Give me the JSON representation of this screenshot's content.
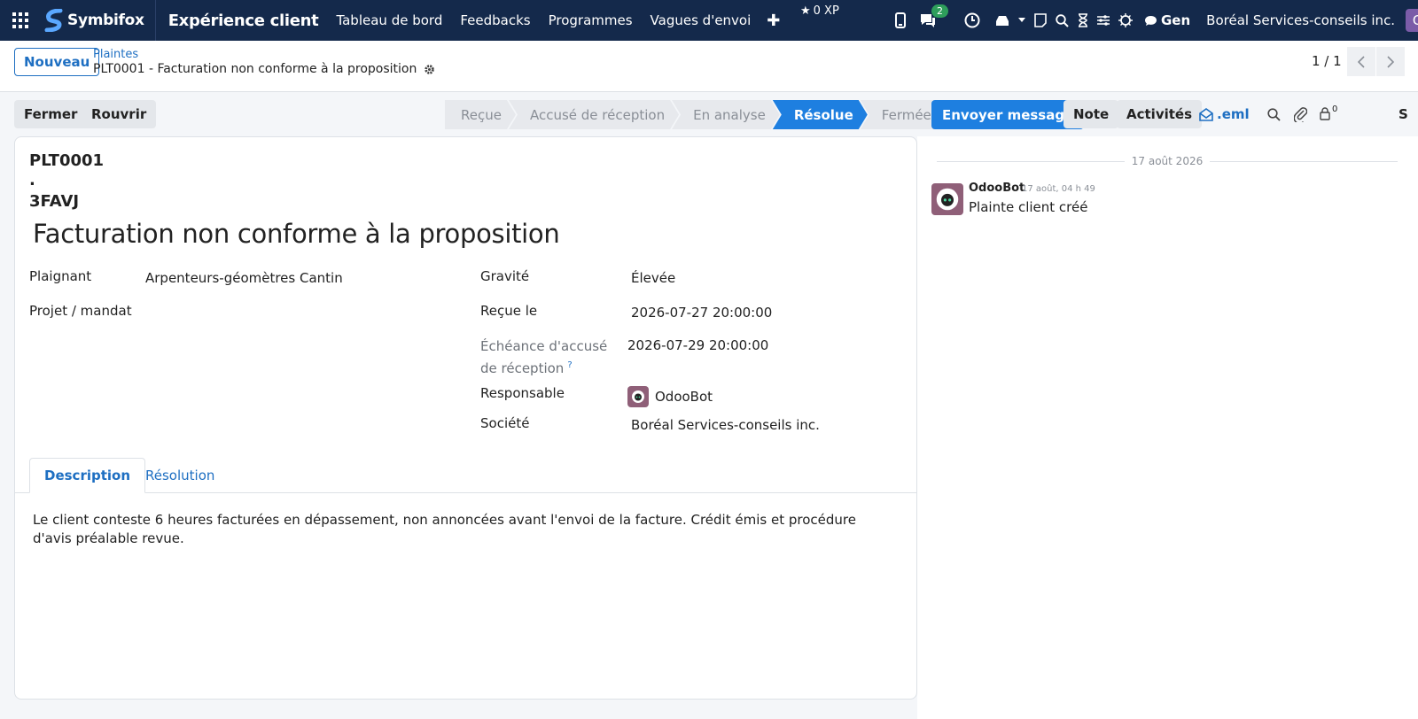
{
  "topbar": {
    "brand": "Symbifox",
    "module": "Expérience client",
    "menus": [
      "Tableau de bord",
      "Feedbacks",
      "Programmes",
      "Vagues d'envoi"
    ],
    "xp": "0 XP",
    "chat_count": "2",
    "gen_label": "Gen",
    "company": "Boréal Services-conseils inc.",
    "avatar_letter": "C",
    "colors": {
      "bar": "#14294b",
      "badge": "#2e9e5b",
      "avatar": "#7b5ca8"
    }
  },
  "control_panel": {
    "new_label": "Nouveau",
    "breadcrumb_parent": "Plaintes",
    "breadcrumb_current": "PLT0001 - Facturation non conforme à la proposition",
    "pager": "1 / 1"
  },
  "actions": {
    "close_label": "Fermer",
    "reopen_label": "Rouvrir"
  },
  "statusbar": {
    "stages": [
      "Reçue",
      "Accusé de réception",
      "En analyse",
      "Résolue",
      "Fermée"
    ],
    "active": "Résolue",
    "active_color": "#1e7fe0"
  },
  "chatter_toolbar": {
    "send_label": "Envoyer message",
    "note_label": "Note",
    "activities_label": "Activités",
    "eml_label": ".eml",
    "follower_count": "0",
    "follow_letter": "S"
  },
  "record": {
    "ref_line1": "PLT0001",
    "ref_line2": ".",
    "ref_line3": "3FAVJ",
    "title": "Facturation non conforme à la proposition",
    "left_fields": [
      {
        "label": "Plaignant",
        "value": "Arpenteurs-géomètres Cantin"
      },
      {
        "label": "Projet / mandat",
        "value": ""
      }
    ],
    "right_fields": [
      {
        "label": "Gravité",
        "value": "Élevée"
      },
      {
        "label": "Reçue le",
        "value": "2026-07-27 20:00:00"
      },
      {
        "label": "Échéance d'accusé de réception",
        "value": "2026-07-29 20:00:00",
        "help": "?"
      },
      {
        "label": "Responsable",
        "value": "OdooBot"
      },
      {
        "label": "Société",
        "value": "Boréal Services-conseils inc."
      }
    ],
    "tabs": [
      "Description",
      "Résolution"
    ],
    "active_tab": "Description",
    "description": "Le client conteste 6 heures facturées en dépassement, non annoncées avant l'envoi de la facture. Crédit émis et procédure d'avis préalable revue."
  },
  "chatter": {
    "date_separator": "17 août 2026",
    "messages": [
      {
        "author": "OdooBot",
        "time": "17 août, 04 h 49",
        "body": "Plainte client créé"
      }
    ]
  }
}
